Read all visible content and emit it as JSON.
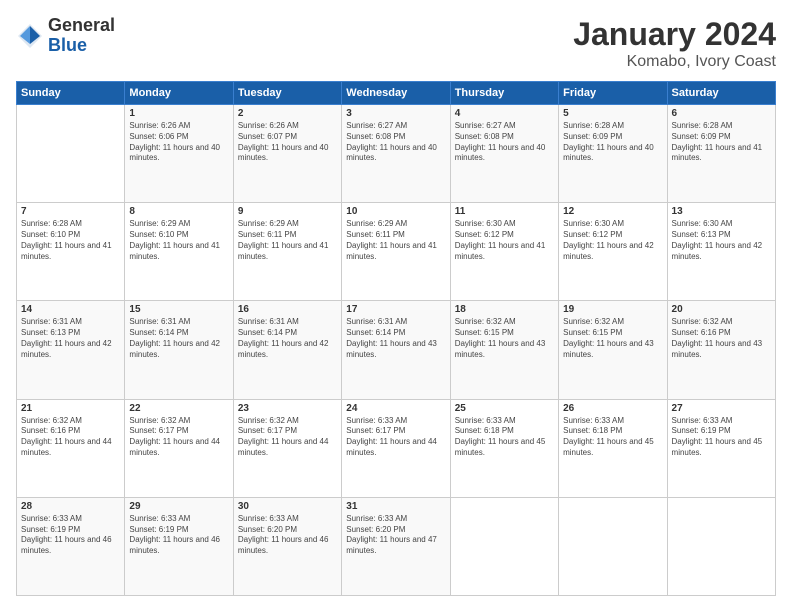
{
  "logo": {
    "general": "General",
    "blue": "Blue"
  },
  "title": "January 2024",
  "location": "Komabo, Ivory Coast",
  "days_header": [
    "Sunday",
    "Monday",
    "Tuesday",
    "Wednesday",
    "Thursday",
    "Friday",
    "Saturday"
  ],
  "weeks": [
    [
      {
        "day": "",
        "content": ""
      },
      {
        "day": "1",
        "content": "Sunrise: 6:26 AM\nSunset: 6:06 PM\nDaylight: 11 hours and 40 minutes."
      },
      {
        "day": "2",
        "content": "Sunrise: 6:26 AM\nSunset: 6:07 PM\nDaylight: 11 hours and 40 minutes."
      },
      {
        "day": "3",
        "content": "Sunrise: 6:27 AM\nSunset: 6:08 PM\nDaylight: 11 hours and 40 minutes."
      },
      {
        "day": "4",
        "content": "Sunrise: 6:27 AM\nSunset: 6:08 PM\nDaylight: 11 hours and 40 minutes."
      },
      {
        "day": "5",
        "content": "Sunrise: 6:28 AM\nSunset: 6:09 PM\nDaylight: 11 hours and 40 minutes."
      },
      {
        "day": "6",
        "content": "Sunrise: 6:28 AM\nSunset: 6:09 PM\nDaylight: 11 hours and 41 minutes."
      }
    ],
    [
      {
        "day": "7",
        "content": "Sunrise: 6:28 AM\nSunset: 6:10 PM\nDaylight: 11 hours and 41 minutes."
      },
      {
        "day": "8",
        "content": "Sunrise: 6:29 AM\nSunset: 6:10 PM\nDaylight: 11 hours and 41 minutes."
      },
      {
        "day": "9",
        "content": "Sunrise: 6:29 AM\nSunset: 6:11 PM\nDaylight: 11 hours and 41 minutes."
      },
      {
        "day": "10",
        "content": "Sunrise: 6:29 AM\nSunset: 6:11 PM\nDaylight: 11 hours and 41 minutes."
      },
      {
        "day": "11",
        "content": "Sunrise: 6:30 AM\nSunset: 6:12 PM\nDaylight: 11 hours and 41 minutes."
      },
      {
        "day": "12",
        "content": "Sunrise: 6:30 AM\nSunset: 6:12 PM\nDaylight: 11 hours and 42 minutes."
      },
      {
        "day": "13",
        "content": "Sunrise: 6:30 AM\nSunset: 6:13 PM\nDaylight: 11 hours and 42 minutes."
      }
    ],
    [
      {
        "day": "14",
        "content": "Sunrise: 6:31 AM\nSunset: 6:13 PM\nDaylight: 11 hours and 42 minutes."
      },
      {
        "day": "15",
        "content": "Sunrise: 6:31 AM\nSunset: 6:14 PM\nDaylight: 11 hours and 42 minutes."
      },
      {
        "day": "16",
        "content": "Sunrise: 6:31 AM\nSunset: 6:14 PM\nDaylight: 11 hours and 42 minutes."
      },
      {
        "day": "17",
        "content": "Sunrise: 6:31 AM\nSunset: 6:14 PM\nDaylight: 11 hours and 43 minutes."
      },
      {
        "day": "18",
        "content": "Sunrise: 6:32 AM\nSunset: 6:15 PM\nDaylight: 11 hours and 43 minutes."
      },
      {
        "day": "19",
        "content": "Sunrise: 6:32 AM\nSunset: 6:15 PM\nDaylight: 11 hours and 43 minutes."
      },
      {
        "day": "20",
        "content": "Sunrise: 6:32 AM\nSunset: 6:16 PM\nDaylight: 11 hours and 43 minutes."
      }
    ],
    [
      {
        "day": "21",
        "content": "Sunrise: 6:32 AM\nSunset: 6:16 PM\nDaylight: 11 hours and 44 minutes."
      },
      {
        "day": "22",
        "content": "Sunrise: 6:32 AM\nSunset: 6:17 PM\nDaylight: 11 hours and 44 minutes."
      },
      {
        "day": "23",
        "content": "Sunrise: 6:32 AM\nSunset: 6:17 PM\nDaylight: 11 hours and 44 minutes."
      },
      {
        "day": "24",
        "content": "Sunrise: 6:33 AM\nSunset: 6:17 PM\nDaylight: 11 hours and 44 minutes."
      },
      {
        "day": "25",
        "content": "Sunrise: 6:33 AM\nSunset: 6:18 PM\nDaylight: 11 hours and 45 minutes."
      },
      {
        "day": "26",
        "content": "Sunrise: 6:33 AM\nSunset: 6:18 PM\nDaylight: 11 hours and 45 minutes."
      },
      {
        "day": "27",
        "content": "Sunrise: 6:33 AM\nSunset: 6:19 PM\nDaylight: 11 hours and 45 minutes."
      }
    ],
    [
      {
        "day": "28",
        "content": "Sunrise: 6:33 AM\nSunset: 6:19 PM\nDaylight: 11 hours and 46 minutes."
      },
      {
        "day": "29",
        "content": "Sunrise: 6:33 AM\nSunset: 6:19 PM\nDaylight: 11 hours and 46 minutes."
      },
      {
        "day": "30",
        "content": "Sunrise: 6:33 AM\nSunset: 6:20 PM\nDaylight: 11 hours and 46 minutes."
      },
      {
        "day": "31",
        "content": "Sunrise: 6:33 AM\nSunset: 6:20 PM\nDaylight: 11 hours and 47 minutes."
      },
      {
        "day": "",
        "content": ""
      },
      {
        "day": "",
        "content": ""
      },
      {
        "day": "",
        "content": ""
      }
    ]
  ]
}
